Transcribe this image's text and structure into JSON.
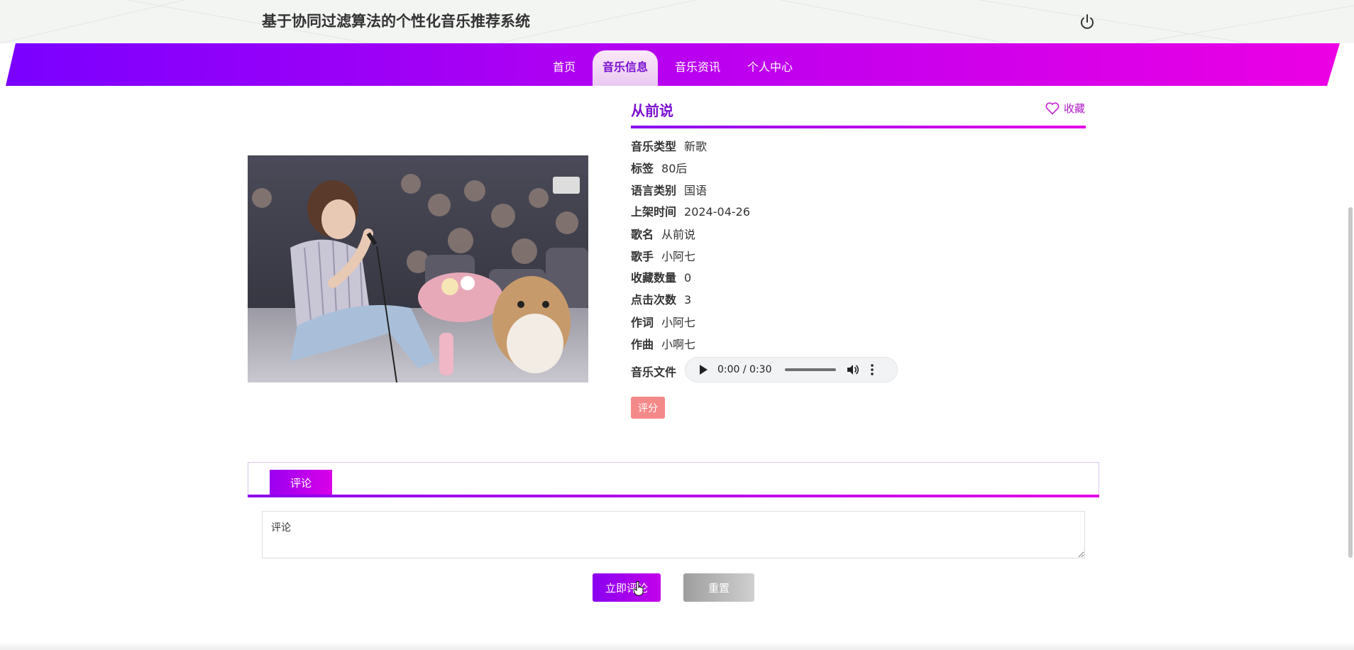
{
  "header": {
    "title": "基于协同过滤算法的个性化音乐推荐系统",
    "icon": "power-icon"
  },
  "nav": {
    "items": [
      {
        "label": "首页",
        "active": false
      },
      {
        "label": "音乐信息",
        "active": true
      },
      {
        "label": "音乐资讯",
        "active": false
      },
      {
        "label": "个人中心",
        "active": false
      }
    ]
  },
  "detail": {
    "title": "从前说",
    "favorite_label": "收藏",
    "fields": [
      {
        "key": "音乐类型",
        "value": "新歌"
      },
      {
        "key": "标签",
        "value": "80后"
      },
      {
        "key": "语言类别",
        "value": "国语"
      },
      {
        "key": "上架时间",
        "value": "2024-04-26"
      },
      {
        "key": "歌名",
        "value": "从前说"
      },
      {
        "key": "歌手",
        "value": "小阿七"
      },
      {
        "key": "收藏数量",
        "value": "0"
      },
      {
        "key": "点击次数",
        "value": "3"
      },
      {
        "key": "作词",
        "value": "小阿七"
      },
      {
        "key": "作曲",
        "value": "小啊七"
      }
    ],
    "audio_label": "音乐文件",
    "audio_time": "0:00 / 0:30",
    "rate_label": "评分"
  },
  "comments": {
    "tab_label": "评论",
    "input_placeholder": "评论",
    "submit_label": "立即评论",
    "reset_label": "重置"
  },
  "colors": {
    "accent": "#8a00f0",
    "accent_end": "#e400e6",
    "rate_button": "#f4898a"
  }
}
